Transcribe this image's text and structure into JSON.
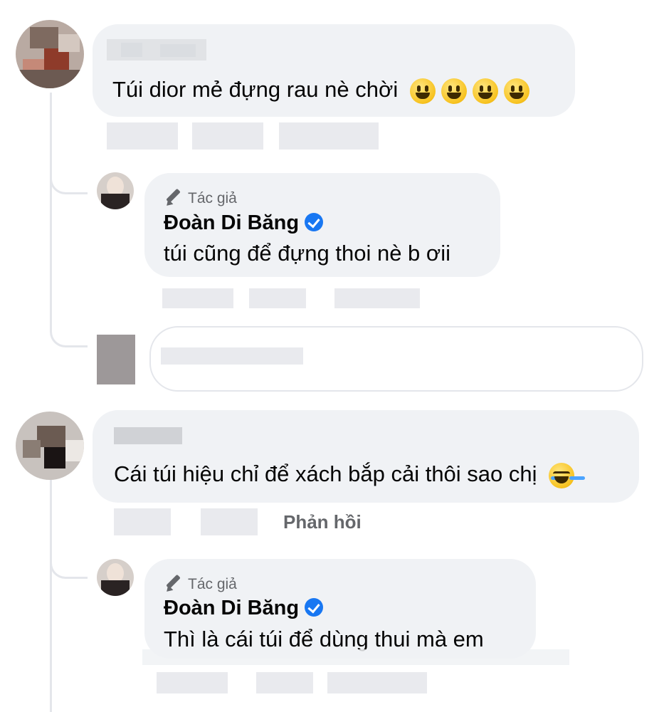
{
  "comments": [
    {
      "author_name": "",
      "text": "Túi dior mẻ đựng rau nè chời",
      "emoji_icons": [
        "smiley-icon",
        "smiley-icon",
        "smiley-icon",
        "smiley-icon"
      ],
      "reply": {
        "badge": "Tác giả",
        "author_name": "Đoàn Di Băng",
        "text": "túi cũng để đựng thoi nè b ơii"
      }
    },
    {
      "author_name": "",
      "text": "Cái túi hiệu chỉ để xách bắp cải thôi sao chị",
      "emoji_icons": [
        "laughing-tears-icon"
      ],
      "reply_action": "Phản hồi",
      "reply": {
        "badge": "Tác giả",
        "author_name": "Đoàn Di Băng",
        "text": "Thì là cái túi để dùng thui mà em"
      }
    }
  ],
  "colors": {
    "bubble": "#f0f2f5",
    "text": "#050505",
    "secondary": "#65676b",
    "verified": "#1877f2",
    "thread_line": "#e4e6eb"
  }
}
